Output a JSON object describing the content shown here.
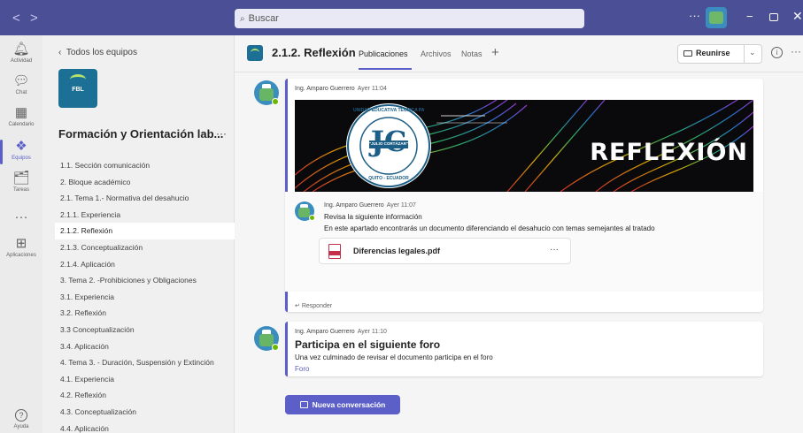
{
  "titlebar": {
    "back_arrow": "<",
    "forward_arrow": ">",
    "search_placeholder": "Buscar",
    "more": "···",
    "minimize": "−",
    "close": "✕"
  },
  "rail": {
    "items": [
      {
        "label": "Actividad",
        "icon": "bell-icon",
        "glyph": "🔔"
      },
      {
        "label": "Chat",
        "icon": "chat-icon",
        "glyph": "💬"
      },
      {
        "label": "Calendario",
        "icon": "calendar-icon",
        "glyph": "▦"
      },
      {
        "label": "Equipos",
        "icon": "teams-icon",
        "glyph": "👥"
      },
      {
        "label": "Tareas",
        "icon": "assignments-icon",
        "glyph": "🗂"
      },
      {
        "label": "",
        "icon": "more-apps-icon",
        "glyph": "···"
      },
      {
        "label": "Aplicaciones",
        "icon": "apps-icon",
        "glyph": "⊞"
      },
      {
        "label": "Ayuda",
        "icon": "help-icon",
        "glyph": "?"
      }
    ],
    "active": "Equipos"
  },
  "sidebar": {
    "back_label": "Todos los equipos",
    "logo_text": "FBL",
    "team_name": "Formación y Orientación lab...",
    "team_more": "···",
    "channels": [
      "1.1. Sección comunicación",
      "2. Bloque académico",
      "2.1. Tema 1.- Normativa del desahucio",
      "2.1.1. Experiencia",
      "2.1.2. Reflexión",
      "2.1.3. Conceptualización",
      "2.1.4. Aplicación",
      "3. Tema 2. -Prohibiciones y Obligaciones",
      "3.1. Experiencia",
      "3.2. Reflexión",
      "3.3 Conceptualización",
      "3.4. Aplicación",
      "4. Tema 3. - Duración, Suspensión y Extinción",
      "4.1. Experiencia",
      "4.2. Reflexión",
      "4.3. Conceptualización",
      "4.4. Aplicación"
    ],
    "active_channel": "2.1.2. Reflexión"
  },
  "header": {
    "channel_title": "2.1.2. Reflexión",
    "tabs": [
      "Publicaciones",
      "Archivos",
      "Notas"
    ],
    "active_tab": "Publicaciones",
    "add_tab": "+",
    "meet_label": "Reunirse",
    "meet_chevron": "⌄",
    "info": "i",
    "more": "···"
  },
  "posts": [
    {
      "author": "Ing. Amparo Guerrero",
      "time": "Ayer 11:04",
      "banner_title": "REFLEXIÓN",
      "banner_logo_text": "JC",
      "banner_ring_text_top": "UNIDAD EDUCATIVA TÉCNICA PARTICULAR",
      "banner_ribbon_text": "\"JULIO CORTÁZAR\"",
      "banner_ring_text_bottom": "QUITO - ECUADOR",
      "reply": {
        "author": "Ing. Amparo Guerrero",
        "time": "Ayer 11:07",
        "line1": "Revisa la siguiente información",
        "line2": "En este apartado encontrarás un documento diferenciando el desahucio con temas semejantes al tratado",
        "file_name": "Diferencias legales.pdf",
        "file_more": "···"
      },
      "reply_action": "Responder"
    },
    {
      "author": "Ing. Amparo Guerrero",
      "time": "Ayer 11:10",
      "title": "Participa en el siguiente foro",
      "body": "Una vez culminado de revisar el  documento participa en el foro",
      "link": "Foro"
    }
  ],
  "new_conversation_label": "Nueva conversación",
  "colors": {
    "brand": "#5b5fc7",
    "titlebar": "#4b4f96",
    "presence": "#6bb700",
    "pdf": "#c4314b"
  }
}
